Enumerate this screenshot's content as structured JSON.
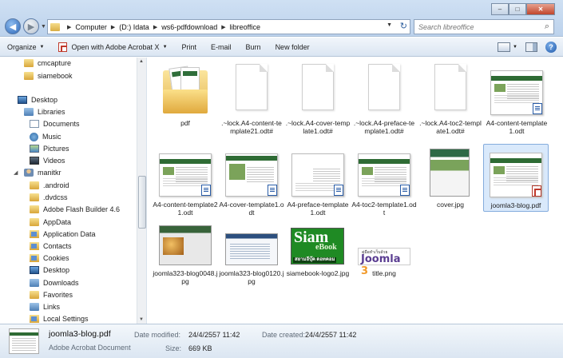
{
  "window": {
    "controls": {
      "minimize": "–",
      "maximize": "□",
      "close": "✕"
    }
  },
  "address": {
    "crumbs": [
      "Computer",
      "(D:) Idata",
      "ws6-pdfdownload",
      "libreoffice"
    ],
    "search_placeholder": "Search libreoffice"
  },
  "toolbar": {
    "organize": "Organize",
    "open_with": "Open with Adobe Acrobat X",
    "print": "Print",
    "email": "E-mail",
    "burn": "Burn",
    "new_folder": "New folder"
  },
  "sidebar": {
    "items": [
      {
        "label": "cmcapture",
        "icon": "folder-icon"
      },
      {
        "label": "siamebook",
        "icon": "folder-icon"
      },
      {
        "label": "Desktop",
        "icon": "desktop-icon"
      },
      {
        "label": "Libraries",
        "icon": "libraries-icon"
      },
      {
        "label": "Documents",
        "icon": "documents-icon"
      },
      {
        "label": "Music",
        "icon": "music-icon"
      },
      {
        "label": "Pictures",
        "icon": "pictures-icon"
      },
      {
        "label": "Videos",
        "icon": "videos-icon"
      },
      {
        "label": "manitkr",
        "icon": "user-icon"
      },
      {
        "label": ".android",
        "icon": "folder-icon"
      },
      {
        "label": ".dvdcss",
        "icon": "folder-icon"
      },
      {
        "label": "Adobe Flash Builder 4.6",
        "icon": "folder-icon"
      },
      {
        "label": "AppData",
        "icon": "folder-icon"
      },
      {
        "label": "Application Data",
        "icon": "shortcut-folder-icon"
      },
      {
        "label": "Contacts",
        "icon": "contacts-icon"
      },
      {
        "label": "Cookies",
        "icon": "shortcut-folder-icon"
      },
      {
        "label": "Desktop",
        "icon": "desktop-icon"
      },
      {
        "label": "Downloads",
        "icon": "downloads-icon"
      },
      {
        "label": "Favorites",
        "icon": "favorites-icon"
      },
      {
        "label": "Links",
        "icon": "links-icon"
      },
      {
        "label": "Local Settings",
        "icon": "shortcut-folder-icon"
      }
    ]
  },
  "files": [
    {
      "name": "pdf",
      "kind": "folder"
    },
    {
      "name": ".~lock.A4-content-template21.odt#",
      "kind": "blank"
    },
    {
      "name": ".~lock.A4-cover-template1.odt#",
      "kind": "blank"
    },
    {
      "name": ".~lock.A4-preface-template1.odt#",
      "kind": "blank"
    },
    {
      "name": ".~lock.A4-toc2-template1.odt#",
      "kind": "blank"
    },
    {
      "name": "A4-content-template1.odt",
      "kind": "odt"
    },
    {
      "name": "A4-content-template21.odt",
      "kind": "odt"
    },
    {
      "name": "A4-cover-template1.odt",
      "kind": "odt"
    },
    {
      "name": "A4-preface-template1.odt",
      "kind": "odt"
    },
    {
      "name": "A4-toc2-template1.odt",
      "kind": "odt"
    },
    {
      "name": "cover.jpg",
      "kind": "jpg"
    },
    {
      "name": "joomla3-blog.pdf",
      "kind": "pdf",
      "selected": true
    },
    {
      "name": "joomla323-blog0048.jpg",
      "kind": "jpg"
    },
    {
      "name": "joomla323-blog0120.jpg",
      "kind": "jpg"
    },
    {
      "name": "siamebook-logo2.jpg",
      "kind": "jpg"
    },
    {
      "name": "title.png",
      "kind": "png"
    }
  ],
  "thumb_text": {
    "siam": "Siam",
    "ebook": "eBook",
    "siam_tagline": "สยามอีบุ๊ค ดอทคอม",
    "title_small": "คู่มือทำเว็บด้วย",
    "title_joomla": "Joomla",
    "title_version": "3"
  },
  "details": {
    "file_name": "joomla3-blog.pdf",
    "file_type": "Adobe Acrobat Document",
    "date_modified_label": "Date modified:",
    "date_modified": "24/4/2557 11:42",
    "date_created_label": "Date created:",
    "date_created": "24/4/2557 11:42",
    "size_label": "Size:",
    "size": "669 KB"
  },
  "colors": {
    "selection_bg": "#d9e9fb",
    "selection_border": "#84acdd",
    "template_green": "#2e6b34"
  }
}
